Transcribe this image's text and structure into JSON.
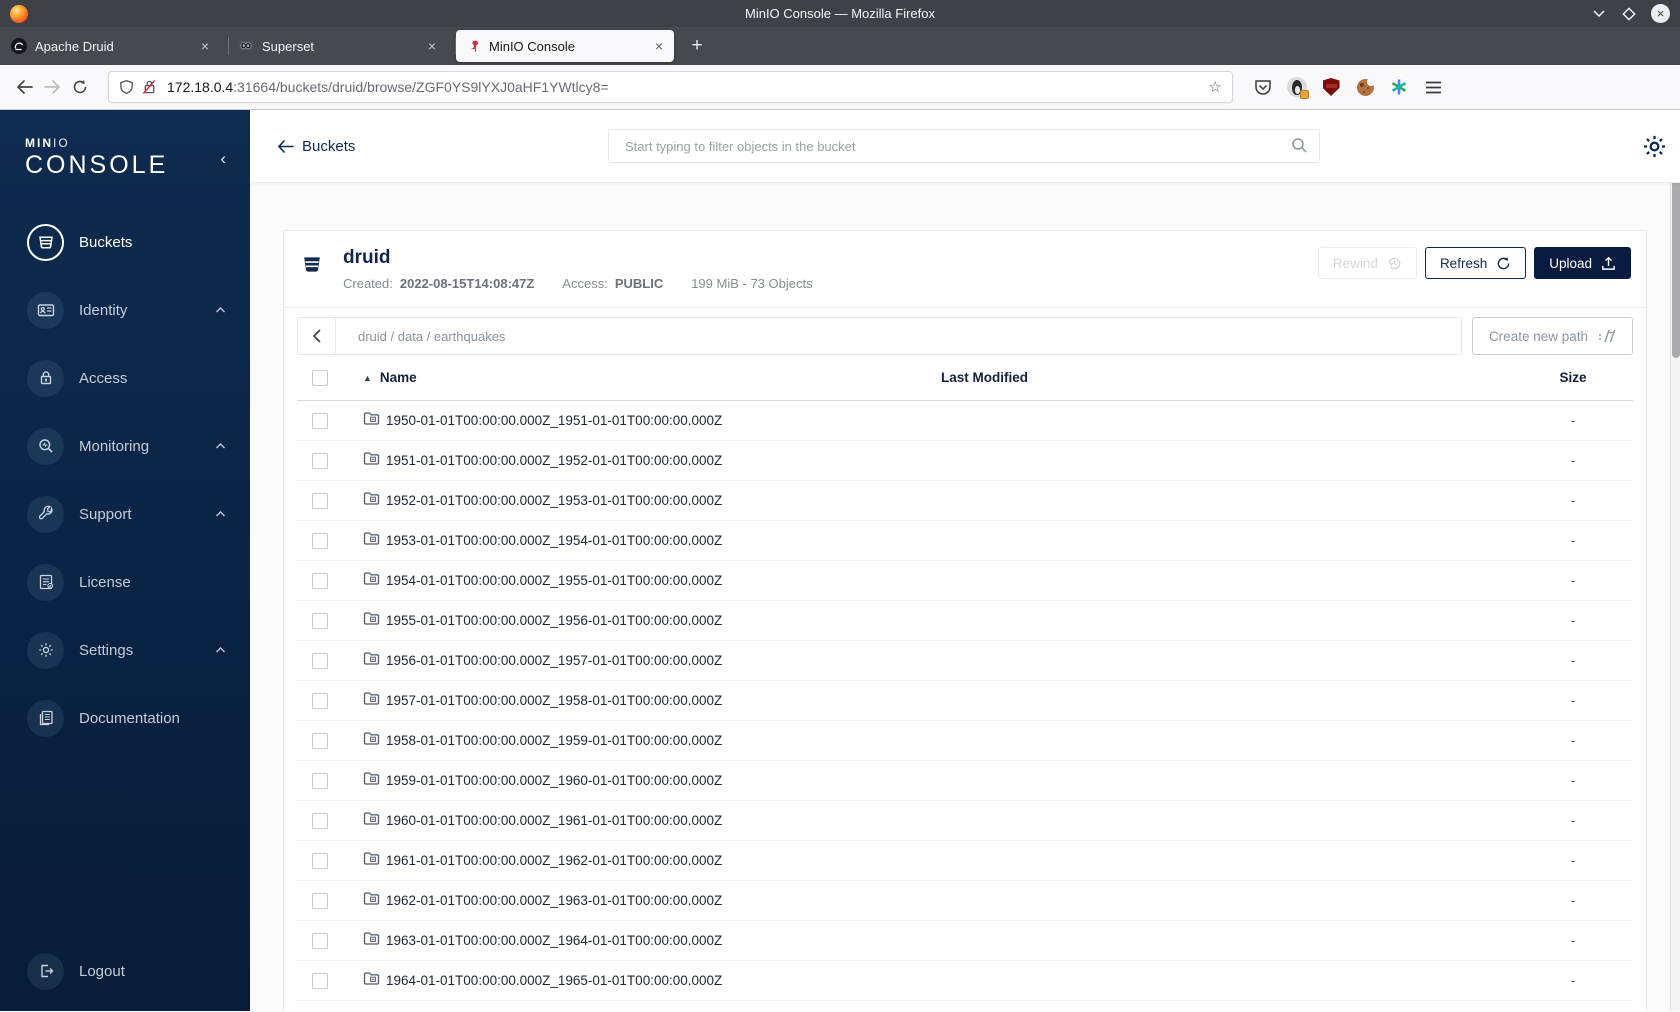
{
  "browser": {
    "window_title": "MinIO Console — Mozilla Firefox",
    "tabs": [
      {
        "title": "Apache Druid"
      },
      {
        "title": "Superset"
      },
      {
        "title": "MinIO Console"
      }
    ],
    "url_host": "172.18.0.4",
    "url_rest": ":31664/buckets/druid/browse/ZGF0YS9lYXJ0aHF1YWtlcy8="
  },
  "sidebar": {
    "brand_top": "MIN",
    "brand_top_light": "IO",
    "brand_bottom": "CONSOLE",
    "items": [
      {
        "label": "Buckets"
      },
      {
        "label": "Identity"
      },
      {
        "label": "Access"
      },
      {
        "label": "Monitoring"
      },
      {
        "label": "Support"
      },
      {
        "label": "License"
      },
      {
        "label": "Settings"
      },
      {
        "label": "Documentation"
      }
    ],
    "logout_label": "Logout"
  },
  "topbar": {
    "back_label": "Buckets",
    "search_placeholder": "Start typing to filter objects in the bucket"
  },
  "bucket": {
    "name": "druid",
    "created_label": "Created:",
    "created_value": "2022-08-15T14:08:47Z",
    "access_label": "Access:",
    "access_value": "PUBLIC",
    "stats": "199 MiB - 73 Objects"
  },
  "actions": {
    "rewind": "Rewind",
    "refresh": "Refresh",
    "upload": "Upload",
    "create_path": "Create new path"
  },
  "breadcrumb": {
    "path": "druid / data / earthquakes"
  },
  "table": {
    "headers": {
      "name": "Name",
      "last_modified": "Last Modified",
      "size": "Size"
    },
    "rows": [
      {
        "name": "1950-01-01T00:00:00.000Z_1951-01-01T00:00:00.000Z",
        "size": "-"
      },
      {
        "name": "1951-01-01T00:00:00.000Z_1952-01-01T00:00:00.000Z",
        "size": "-"
      },
      {
        "name": "1952-01-01T00:00:00.000Z_1953-01-01T00:00:00.000Z",
        "size": "-"
      },
      {
        "name": "1953-01-01T00:00:00.000Z_1954-01-01T00:00:00.000Z",
        "size": "-"
      },
      {
        "name": "1954-01-01T00:00:00.000Z_1955-01-01T00:00:00.000Z",
        "size": "-"
      },
      {
        "name": "1955-01-01T00:00:00.000Z_1956-01-01T00:00:00.000Z",
        "size": "-"
      },
      {
        "name": "1956-01-01T00:00:00.000Z_1957-01-01T00:00:00.000Z",
        "size": "-"
      },
      {
        "name": "1957-01-01T00:00:00.000Z_1958-01-01T00:00:00.000Z",
        "size": "-"
      },
      {
        "name": "1958-01-01T00:00:00.000Z_1959-01-01T00:00:00.000Z",
        "size": "-"
      },
      {
        "name": "1959-01-01T00:00:00.000Z_1960-01-01T00:00:00.000Z",
        "size": "-"
      },
      {
        "name": "1960-01-01T00:00:00.000Z_1961-01-01T00:00:00.000Z",
        "size": "-"
      },
      {
        "name": "1961-01-01T00:00:00.000Z_1962-01-01T00:00:00.000Z",
        "size": "-"
      },
      {
        "name": "1962-01-01T00:00:00.000Z_1963-01-01T00:00:00.000Z",
        "size": "-"
      },
      {
        "name": "1963-01-01T00:00:00.000Z_1964-01-01T00:00:00.000Z",
        "size": "-"
      },
      {
        "name": "1964-01-01T00:00:00.000Z_1965-01-01T00:00:00.000Z",
        "size": "-"
      }
    ]
  }
}
